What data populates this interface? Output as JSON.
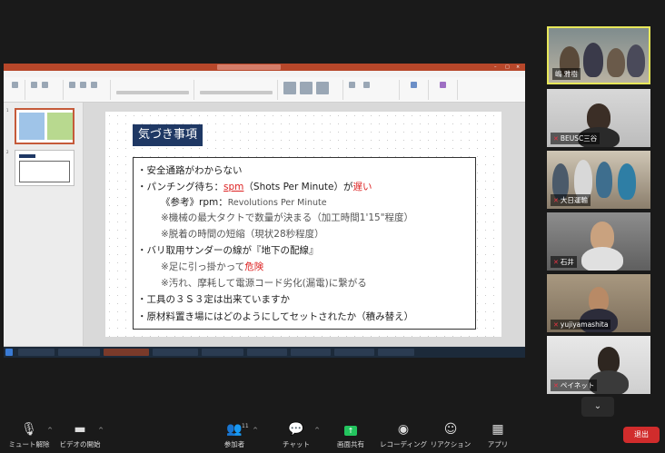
{
  "slide": {
    "title": "気づき事項",
    "lines": [
      "・安全通路がわからない",
      "・パンチング待ち：",
      "spm",
      "（Shots Per Minute）が",
      "遅い",
      "《参考》rpm：",
      "Revolutions Per Minute",
      "※機械の最大タクトで数量が決まる（加工時間1'15\"程度）",
      "※脱着の時間の短縮（現状28秒程度）",
      "・バリ取用サンダーの線が『地下の配線』",
      "※足に引っ掛かって",
      "危険",
      "※汚れ、摩耗して電源コード劣化(漏電)に繋がる",
      "・工具の３Ｓ３定は出来ていますか",
      "・原材料置き場にはどのようにしてセットされたか（積み替え）"
    ]
  },
  "participants": [
    {
      "name": "嶋 雅樹"
    },
    {
      "name": "BEUSC三谷"
    },
    {
      "name": "大日運輸"
    },
    {
      "name": "石井"
    },
    {
      "name": "yujiyamashita"
    },
    {
      "name": "ペイネット"
    }
  ],
  "toolbar": {
    "unmute": "ミュート解除",
    "video": "ビデオの開始",
    "participants": "参加者",
    "participants_count": "11",
    "chat": "チャット",
    "share": "画面共有",
    "record": "レコーディング",
    "reactions": "リアクション",
    "apps": "アプリ",
    "end": "退出"
  },
  "colors": {
    "ppt_accent": "#b7472a",
    "slide_title_bg": "#1f3864",
    "highlight_red": "#dd2222",
    "active_speaker": "#e8e85a",
    "share_green": "#23c45e",
    "end_red": "#d12c2c"
  }
}
